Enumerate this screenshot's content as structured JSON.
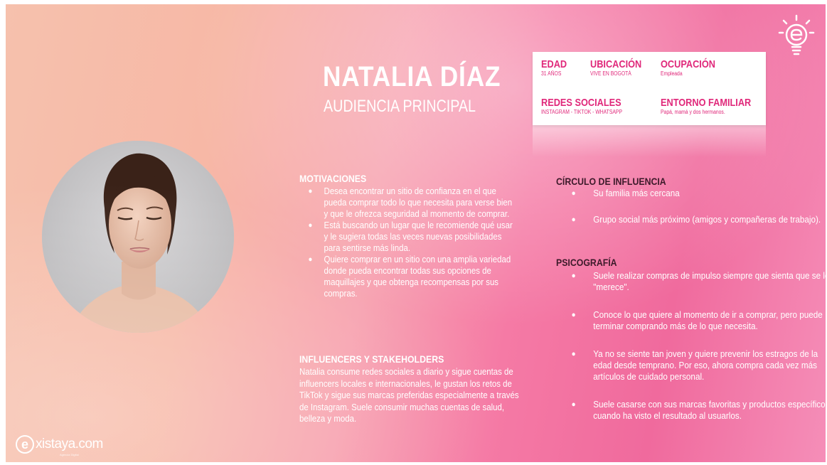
{
  "persona": {
    "name": "NATALIA DÍAZ",
    "role": "AUDIENCIA PRINCIPAL"
  },
  "info_card": {
    "edad": {
      "label": "EDAD",
      "value": "31 AÑOS"
    },
    "ubicacion": {
      "label": "UBICACIÓN",
      "value": "VIVE EN BOGOTÁ"
    },
    "ocupacion": {
      "label": "OCUPACIÓN",
      "value": "Empleada"
    },
    "redes": {
      "label": "REDES SOCIALES",
      "value": "INSTAGRAM - TIKTOK - WHATSAPP"
    },
    "entorno": {
      "label": "ENTORNO FAMILIAR",
      "value": "Papá, mamá y dos hermanos."
    }
  },
  "motivaciones": {
    "title": "MOTIVACIONES",
    "items": [
      "Desea encontrar un sitio de confianza en el que pueda comprar todo lo que necesita para verse bien y que le ofrezca seguridad al momento de comprar.",
      "Está buscando un lugar que le recomiende qué usar y le sugiera todas las veces nuevas posibilidades para sentirse más linda.",
      "Quiere comprar en un sitio con una amplia variedad donde pueda encontrar todas sus opciones de maquillajes y que obtenga recompensas por sus compras."
    ]
  },
  "influencers": {
    "title": "INFLUENCERS Y STAKEHOLDERS",
    "text": "Natalia consume redes sociales a diario y sigue cuentas de influencers locales e internacionales, le gustan los retos de TikTok y sigue sus marcas preferidas especialmente a través de Instagram. Suele consumir muchas cuentas de salud, belleza y moda."
  },
  "circulo": {
    "title": "CÍRCULO DE INFLUENCIA",
    "items": [
      "Su familia más cercana",
      "Grupo social más próximo (amigos y compañeras de trabajo)."
    ]
  },
  "psicografia": {
    "title": "PSICOGRAFÍA",
    "items": [
      "Suele realizar compras de impulso siempre que sienta que se los \"merece\".",
      "Conoce lo que quiere al momento de ir a comprar, pero puede terminar comprando más de lo que necesita.",
      "Ya no se siente tan joven y quiere prevenir los estragos de la edad desde temprano. Por eso, ahora compra cada vez más artículos de cuidado personal.",
      "Suele casarse con sus marcas favoritas y productos específicos cuando ha visto el resultado al usuarlos."
    ]
  },
  "bullet_glyph": "●",
  "logo": {
    "text": "xistaya.com",
    "mark": "e",
    "tagline": "Agencia Digital"
  },
  "colors": {
    "accent": "#e0287a",
    "text_on_bg": "#ffffff",
    "heading_dark": "#3d1a2a"
  },
  "icons": {
    "corner": "lightbulb-e-icon",
    "photo": "woman-portrait"
  }
}
